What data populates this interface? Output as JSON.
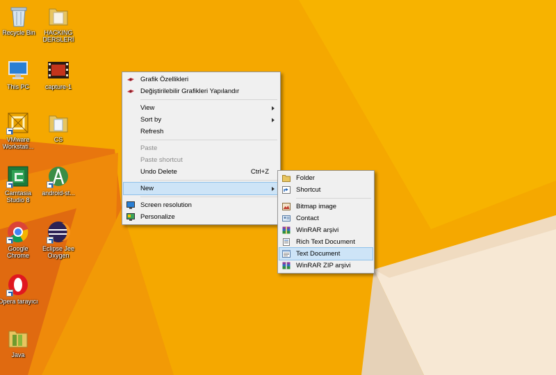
{
  "desktop": {
    "icons": [
      {
        "label": "Recycle Bin",
        "icon": "recycle-bin-icon"
      },
      {
        "label": "HACKING DERSLERİ",
        "icon": "folder-icon"
      },
      {
        "label": "This PC",
        "icon": "computer-icon"
      },
      {
        "label": "capture-1",
        "icon": "video-file-icon"
      },
      {
        "label": "VMware Workstati...",
        "icon": "vmware-icon"
      },
      {
        "label": "CS",
        "icon": "folder-icon"
      },
      {
        "label": "Camtasia Studio 8",
        "icon": "camtasia-icon"
      },
      {
        "label": "android-st...",
        "icon": "android-studio-icon"
      },
      {
        "label": "Google Chrome",
        "icon": "chrome-icon"
      },
      {
        "label": "Eclipse Jee Oxygen",
        "icon": "eclipse-icon"
      },
      {
        "label": "Opera tarayıcı",
        "icon": "opera-icon"
      },
      {
        "label": "Java",
        "icon": "folder-icon"
      }
    ]
  },
  "context_menu": {
    "items": [
      {
        "label": "Grafik Özellikleri",
        "icon": "intel-graphics-icon"
      },
      {
        "label": "Değiştirilebilir Grafikleri Yapılandır",
        "icon": "intel-graphics-icon"
      },
      {
        "label": "View",
        "submenu": true
      },
      {
        "label": "Sort by",
        "submenu": true
      },
      {
        "label": "Refresh"
      },
      {
        "label": "Paste",
        "disabled": true
      },
      {
        "label": "Paste shortcut",
        "disabled": true
      },
      {
        "label": "Undo Delete",
        "shortcut": "Ctrl+Z"
      },
      {
        "label": "New",
        "submenu": true,
        "highlighted": true
      },
      {
        "label": "Screen resolution",
        "icon": "screen-resolution-icon"
      },
      {
        "label": "Personalize",
        "icon": "personalize-icon"
      }
    ]
  },
  "new_submenu": {
    "items": [
      {
        "label": "Folder",
        "icon": "folder-icon"
      },
      {
        "label": "Shortcut",
        "icon": "shortcut-icon"
      },
      {
        "label": "Bitmap image",
        "icon": "bitmap-icon"
      },
      {
        "label": "Contact",
        "icon": "contact-icon"
      },
      {
        "label": "WinRAR arşivi",
        "icon": "winrar-icon"
      },
      {
        "label": "Rich Text Document",
        "icon": "rich-text-icon"
      },
      {
        "label": "Text Document",
        "icon": "text-document-icon",
        "highlighted": true
      },
      {
        "label": "WinRAR ZIP arşivi",
        "icon": "winrar-zip-icon"
      }
    ]
  },
  "colors": {
    "wallpaper_main": "#f5a800",
    "wallpaper_dark": "#e46f0c",
    "wallpaper_cream": "#f6e6cf",
    "menu_bg": "#f0f0f0",
    "menu_highlight": "#cde4f7"
  }
}
